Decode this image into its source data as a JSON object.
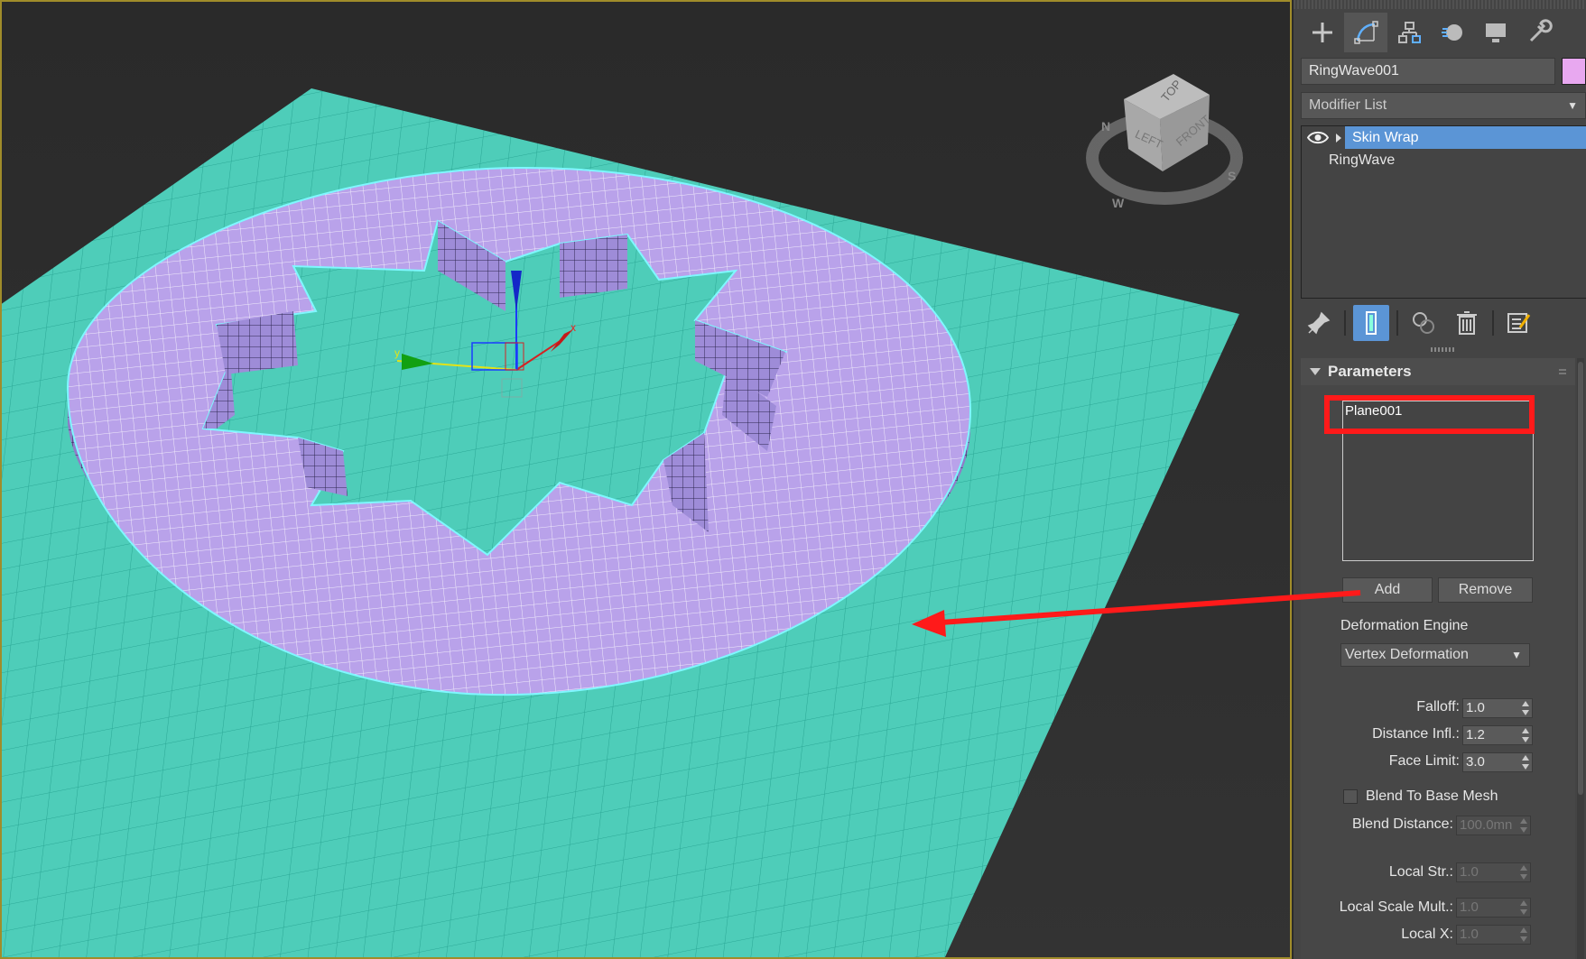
{
  "command_panel": {
    "tabs": [
      {
        "name": "create",
        "icon": "plus-icon"
      },
      {
        "name": "modify",
        "icon": "modify-curve-icon",
        "active": true
      },
      {
        "name": "hierarchy",
        "icon": "hierarchy-icon"
      },
      {
        "name": "motion",
        "icon": "motion-sphere-icon"
      },
      {
        "name": "display",
        "icon": "monitor-icon"
      },
      {
        "name": "utilities",
        "icon": "wrench-icon"
      }
    ],
    "object_name": "RingWave001",
    "object_color": "#e8a8f0",
    "modifier_list_label": "Modifier List",
    "stack": [
      {
        "label": "Skin Wrap",
        "selected": true
      },
      {
        "label": "RingWave",
        "selected": false
      }
    ],
    "stack_tools": [
      "pin-stack-icon",
      "show-end-result-icon",
      "make-unique-icon",
      "remove-modifier-icon",
      "configure-sets-icon"
    ]
  },
  "parameters": {
    "title": "Parameters",
    "target_objects": [
      "Plane001"
    ],
    "add_label": "Add",
    "remove_label": "Remove",
    "deformation_engine_label": "Deformation Engine",
    "deformation_engine_value": "Vertex Deformation",
    "falloff_label": "Falloff:",
    "falloff_value": "1.0",
    "distance_infl_label": "Distance Infl.:",
    "distance_infl_value": "1.2",
    "face_limit_label": "Face Limit:",
    "face_limit_value": "3.0",
    "blend_label": "Blend To Base Mesh",
    "blend_checked": false,
    "blend_distance_label": "Blend Distance:",
    "blend_distance_value": "100.0mn",
    "local_str_label": "Local Str.:",
    "local_str_value": "1.0",
    "local_scale_label": "Local Scale Mult.:",
    "local_scale_value": "1.0",
    "local_x_label": "Local X:",
    "local_x_value": "1.0"
  },
  "viewcube": {
    "faces": [
      "TOP",
      "LEFT",
      "FRONT"
    ],
    "compass": [
      "N",
      "W",
      "S"
    ]
  },
  "gizmo": {
    "x_label": "x",
    "y_label": "y"
  },
  "colors": {
    "plane": "#4ecdb9",
    "ring": "#b9a2ea",
    "ring_side": "#8f7cc8",
    "selection_outline": "#7ff7ff",
    "annotation": "#ff1a1a",
    "viewport_border": "#a08c2a",
    "selected_modifier": "#5b95d6"
  }
}
